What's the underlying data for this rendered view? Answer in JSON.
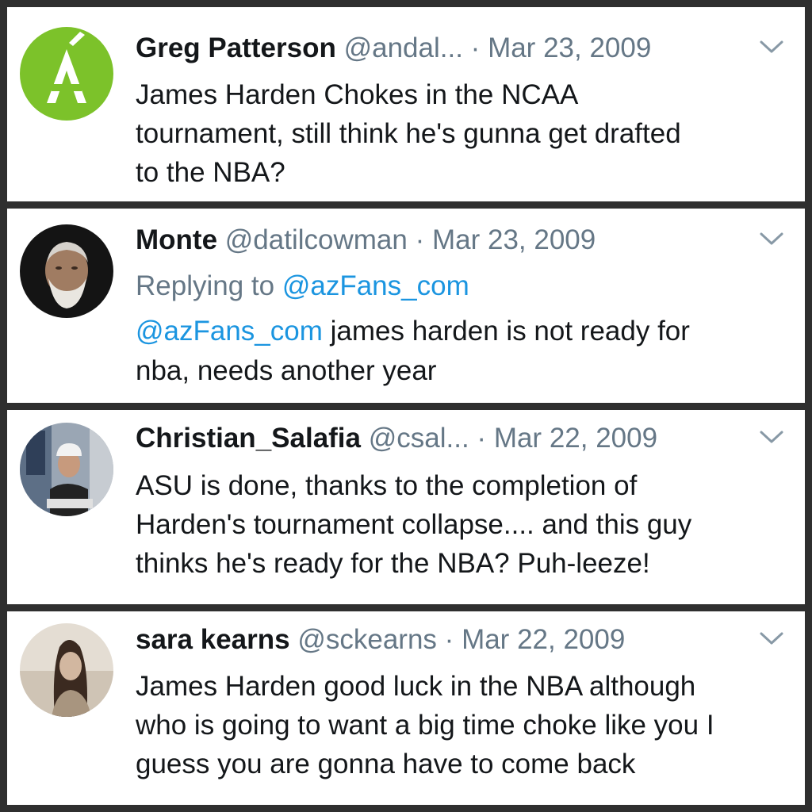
{
  "colors": {
    "link": "#1b95e0",
    "muted": "#657786",
    "text": "#14171a",
    "frame": "#2f2f2f"
  },
  "tweets": [
    {
      "name": "Greg Patterson",
      "handle": "@andal...",
      "separator": "·",
      "date": "Mar 23, 2009",
      "avatar": "green-circle-accented-a-logo",
      "lines": [
        "James Harden Chokes in the NCAA",
        "tournament, still think he's gunna get drafted",
        "to the NBA?"
      ]
    },
    {
      "name": "Monte",
      "handle": "@datilcowman",
      "separator": "·",
      "date": "Mar 23, 2009",
      "avatar": "bearded-man-photo",
      "replying_label": "Replying to",
      "replying_to": "@azFans_com",
      "mention": "@azFans_com",
      "line1_rest": " james harden is not ready for",
      "line2": "nba, needs another year"
    },
    {
      "name": "Christian_Salafia",
      "handle": "@csal...",
      "separator": "·",
      "date": "Mar 22, 2009",
      "avatar": "man-in-cap-photo",
      "lines": [
        "ASU is done, thanks to the completion of",
        "Harden's tournament collapse.... and this guy",
        "thinks he's ready for the NBA?  Puh-leeze!"
      ]
    },
    {
      "name": "sara kearns",
      "handle": "@sckearns",
      "separator": "·",
      "date": "Mar 22, 2009",
      "avatar": "woman-sepia-photo",
      "lines": [
        "James Harden good luck in the NBA although",
        "who is going to want a big time choke like you I",
        "guess you are gonna have to come back"
      ]
    }
  ]
}
